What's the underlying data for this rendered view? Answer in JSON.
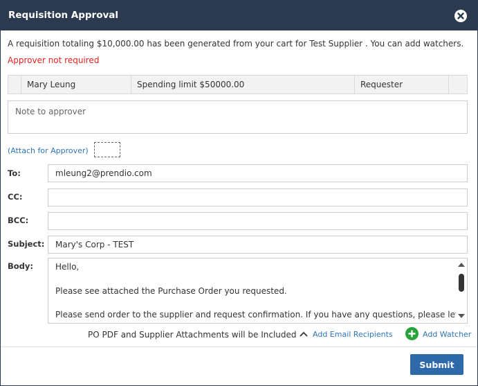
{
  "dialog": {
    "title": "Requisition Approval",
    "close_icon": "close-icon",
    "info_text": "A requisition totaling $10,000.00 has been generated from your cart for Test Supplier . You can add watchers.",
    "warning_text": "Approver not required"
  },
  "approver_table": {
    "row": [
      "Mary Leung",
      "Spending limit $50000.00",
      "Requester"
    ]
  },
  "note": {
    "placeholder": "Note to approver"
  },
  "attach": {
    "label": "(Attach for Approver)"
  },
  "email": {
    "to_label": "To:",
    "to_value": "mleung2@prendio.com",
    "cc_label": "CC:",
    "cc_value": "",
    "bcc_label": "BCC:",
    "bcc_value": "",
    "subject_label": "Subject:",
    "subject_value": "Mary's Corp - TEST",
    "body_label": "Body:",
    "body_lines": [
      "Hello,",
      "Please see attached the Purchase Order you requested.",
      "Please send order to the supplier and request confirmation. If you have any questions, please let"
    ]
  },
  "footer": {
    "attachments_text": "PO PDF and Supplier Attachments will be Included",
    "add_email_recipients": "Add Email Recipients",
    "add_watcher": "Add Watcher",
    "submit": "Submit"
  },
  "colors": {
    "titlebar": "#2b3a4f",
    "link": "#2e75b6",
    "warning": "#e8221f",
    "submit": "#2e6aa9",
    "add_icon": "#28a33a"
  }
}
